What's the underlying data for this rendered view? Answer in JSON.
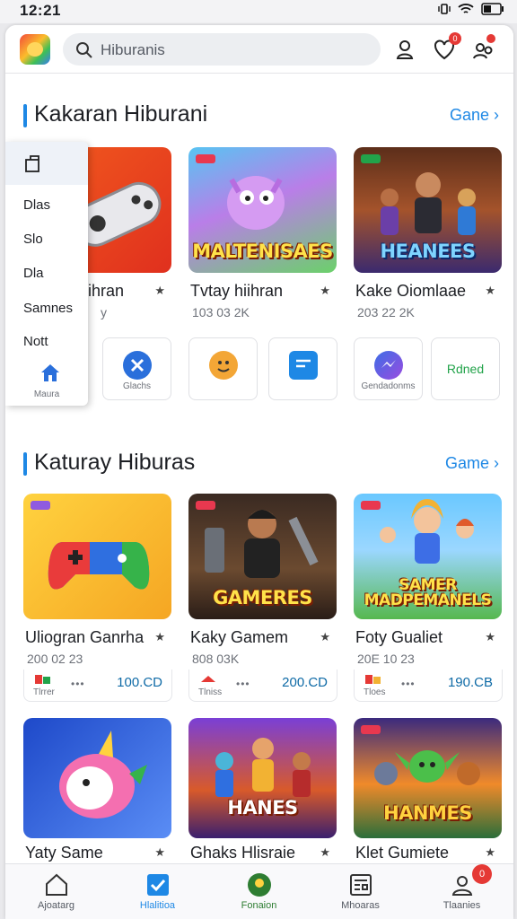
{
  "status": {
    "time": "12:21"
  },
  "search": {
    "value": "Hiburanis"
  },
  "sections": [
    {
      "title": "Kakaran Hiburani",
      "more": "Gane"
    },
    {
      "title": "Katuray Hiburas",
      "more": "Game"
    }
  ],
  "menu": {
    "items": [
      "Dlas",
      "Slo",
      "Dla",
      "Samnes",
      "Nott"
    ],
    "home_label": "Maura"
  },
  "row1": [
    {
      "name": "ihran",
      "meta": "y",
      "thumb_text": ""
    },
    {
      "name": "Tvtay hiihran",
      "meta": "103 03 2K",
      "thumb_text": "MALTENISAES"
    },
    {
      "name": "Kake Oiomlaae",
      "meta": "203 22 2K",
      "thumb_text": "HEANEES"
    }
  ],
  "categories": [
    {
      "label": "Glachs",
      "color": "#2a6fdb"
    },
    {
      "label": "",
      "color": "#f3a636"
    },
    {
      "label": "",
      "color": "#1e88e5"
    },
    {
      "label": "Gendadonms",
      "color": "#3d6ee6"
    },
    {
      "label": "Rdned",
      "color": "#22a34a"
    }
  ],
  "row2": [
    {
      "name": "Uliogran Ganrha",
      "meta": "200 02 23",
      "price_label": "Tlrrer",
      "price": "100.CD",
      "thumb_text": ""
    },
    {
      "name": "Kaky Gamem",
      "meta": "808 03K",
      "price_label": "Tlniss",
      "price": "200.CD",
      "thumb_text": "GAMERES"
    },
    {
      "name": "Foty Gualiet",
      "meta": "20E 10 23",
      "price_label": "Tloes",
      "price": "190.CB",
      "thumb_text": "SAMER MADPEMANELS"
    }
  ],
  "row3": [
    {
      "name": "Yaty Same",
      "thumb_text": ""
    },
    {
      "name": "Ghaks Hlisraie",
      "thumb_text": "HANES"
    },
    {
      "name": "Klet Gumiete",
      "thumb_text": "HANMES"
    }
  ],
  "nav": [
    {
      "label": "Ajoatarg"
    },
    {
      "label": "Hlalitioa"
    },
    {
      "label": "Fonaion"
    },
    {
      "label": "Mhoaras"
    },
    {
      "label": "Tlaanies"
    }
  ],
  "badges": {
    "notifications": "0",
    "nav_profile": "0"
  },
  "colors": {
    "accent": "#1e88e5",
    "badge": "#e53935",
    "price": "#0e6aa6"
  }
}
